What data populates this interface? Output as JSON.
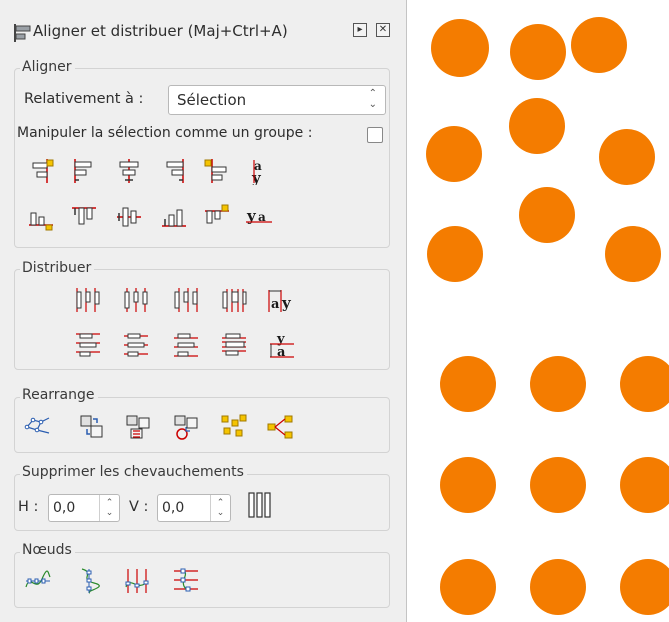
{
  "dialog": {
    "title": "Aligner et distribuer (Maj+Ctrl+A)",
    "title_icon": "align-distribute-icon",
    "buttons": [
      "dock-toggle-icon",
      "close-icon"
    ]
  },
  "align": {
    "legend": "Aligner",
    "relative_label": "Relativement à :",
    "relative_value": "Sélection",
    "group_label": "Manipuler la sélection comme un groupe :",
    "group_checked": false,
    "row1_icons": [
      "align-right-edges-of-objects-to-left-edge-icon",
      "align-left-edges-icon",
      "center-on-vertical-axis-icon",
      "align-right-edges-icon",
      "align-left-edges-of-objects-to-right-edge-icon",
      "align-baseline-anchors-horizontal-icon"
    ],
    "row2_icons": [
      "align-bottom-edges-to-top-edge-icon",
      "align-top-edges-icon",
      "center-on-horizontal-axis-icon",
      "align-bottom-edges-icon",
      "align-top-edges-to-bottom-edge-icon",
      "align-baselines-vertical-icon"
    ]
  },
  "distribute": {
    "legend": "Distribuer",
    "row1_icons": [
      "distribute-left-edges-icon",
      "distribute-centers-horizontal-icon",
      "distribute-right-edges-icon",
      "distribute-horizontal-gaps-icon",
      "distribute-baselines-horizontal-icon"
    ],
    "row2_icons": [
      "distribute-top-edges-icon",
      "distribute-centers-vertical-icon",
      "distribute-bottom-edges-icon",
      "distribute-vertical-gaps-icon",
      "distribute-baselines-vertical-icon"
    ]
  },
  "rearrange": {
    "legend": "Rearrange",
    "icons": [
      "graph-layout-icon",
      "exchange-positions-selection-order-icon",
      "exchange-positions-stacking-order-icon",
      "exchange-positions-clockwise-icon",
      "randomize-centers-icon",
      "unclump-icon"
    ]
  },
  "overlap": {
    "legend": "Supprimer les chevauchements",
    "h_label": "H :",
    "h_value": "0,0",
    "v_label": "V :",
    "v_value": "0,0",
    "apply_icon": "remove-overlaps-icon"
  },
  "nodes": {
    "legend": "Nœuds",
    "icons": [
      "align-nodes-horizontal-icon",
      "align-nodes-vertical-icon",
      "distribute-nodes-horizontal-icon",
      "distribute-nodes-vertical-icon"
    ]
  },
  "canvas": {
    "circle_color": "#f47c00",
    "circle_count": 18
  }
}
